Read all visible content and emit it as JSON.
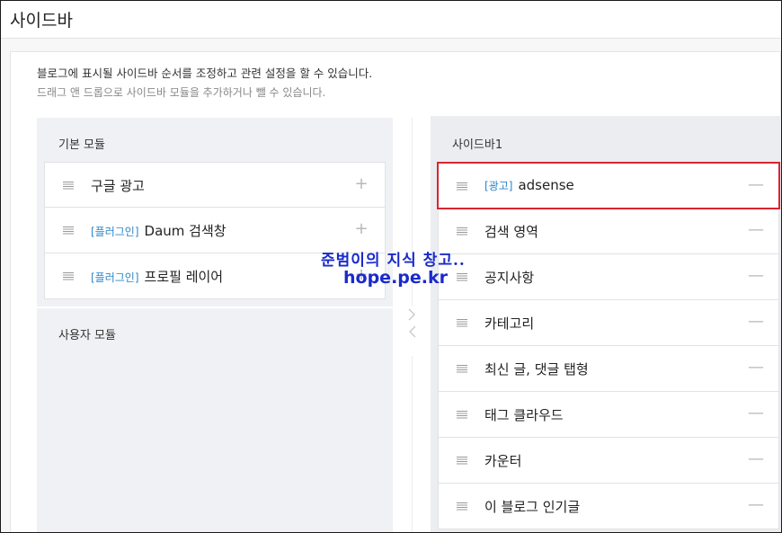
{
  "page": {
    "title": "사이드바",
    "description_1": "블로그에 표시될 사이드바 순서를 조정하고 관련 설정을 할 수 있습니다.",
    "description_2": "드래그 앤 드롭으로 사이드바 모듈을 추가하거나 뺄 수 있습니다."
  },
  "basic_modules": {
    "title": "기본 모듈",
    "items": [
      {
        "tag": "",
        "label": "구글 광고",
        "action": "+"
      },
      {
        "tag": "[플러그인]",
        "label": "Daum 검색창",
        "action": "+"
      },
      {
        "tag": "[플러그인]",
        "label": "프로필 레이어",
        "action": "+"
      }
    ]
  },
  "user_modules": {
    "title": "사용자 모듈"
  },
  "sidebar1": {
    "title": "사이드바1",
    "items": [
      {
        "tag": "[광고]",
        "label": "adsense",
        "action": "—"
      },
      {
        "tag": "",
        "label": "검색 영역",
        "action": "—"
      },
      {
        "tag": "",
        "label": "공지사항",
        "action": "—"
      },
      {
        "tag": "",
        "label": "카테고리",
        "action": "—"
      },
      {
        "tag": "",
        "label": "최신 글, 댓글 탭형",
        "action": "—"
      },
      {
        "tag": "",
        "label": "태그 클라우드",
        "action": "—"
      },
      {
        "tag": "",
        "label": "카운터",
        "action": "—"
      },
      {
        "tag": "",
        "label": "이 블로그 인기글",
        "action": "—"
      }
    ]
  },
  "watermark": {
    "line1": "준범이의 지식 창고..",
    "line2": "hope.pe.kr"
  },
  "colors": {
    "highlight": "#d9262f",
    "tag": "#2d86c9",
    "watermark": "#1a2acb"
  }
}
